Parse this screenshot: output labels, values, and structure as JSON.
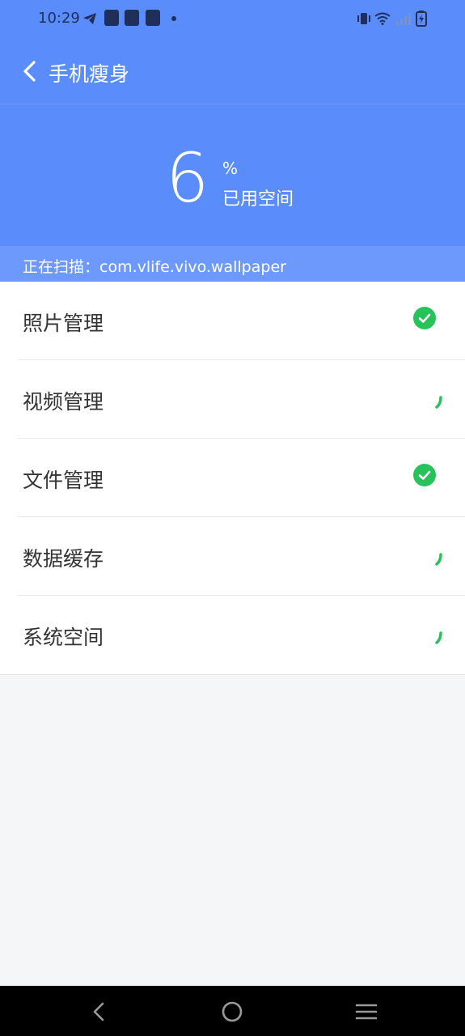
{
  "status_bar": {
    "time": "10:29",
    "icons": [
      "telegram-icon",
      "bag-icon",
      "bag-icon",
      "bag-icon",
      "dot-icon",
      "vibrate-icon",
      "wifi-icon",
      "signal-icon",
      "battery-charging-icon"
    ]
  },
  "header": {
    "title": "手机瘦身",
    "back_icon": "chevron-left-icon"
  },
  "storage": {
    "value": "6",
    "unit": "%",
    "label": "已用空间"
  },
  "scan": {
    "text": "正在扫描：com.vlife.vivo.wallpaper"
  },
  "items": [
    {
      "label": "照片管理",
      "status": "done",
      "status_icon": "check-circle-icon"
    },
    {
      "label": "视频管理",
      "status": "scanning",
      "status_icon": "spinner-icon"
    },
    {
      "label": "文件管理",
      "status": "done",
      "status_icon": "check-circle-icon"
    },
    {
      "label": "数据缓存",
      "status": "scanning",
      "status_icon": "spinner-icon"
    },
    {
      "label": "系统空间",
      "status": "scanning",
      "status_icon": "spinner-icon"
    }
  ],
  "navigation": {
    "back": "nav-back-icon",
    "home": "nav-home-icon",
    "menu": "nav-menu-icon"
  },
  "colors": {
    "primary": "#5a8cfb",
    "scan_bar": "#6c99fb",
    "success": "#27c35a",
    "background": "#f5f6f8"
  }
}
